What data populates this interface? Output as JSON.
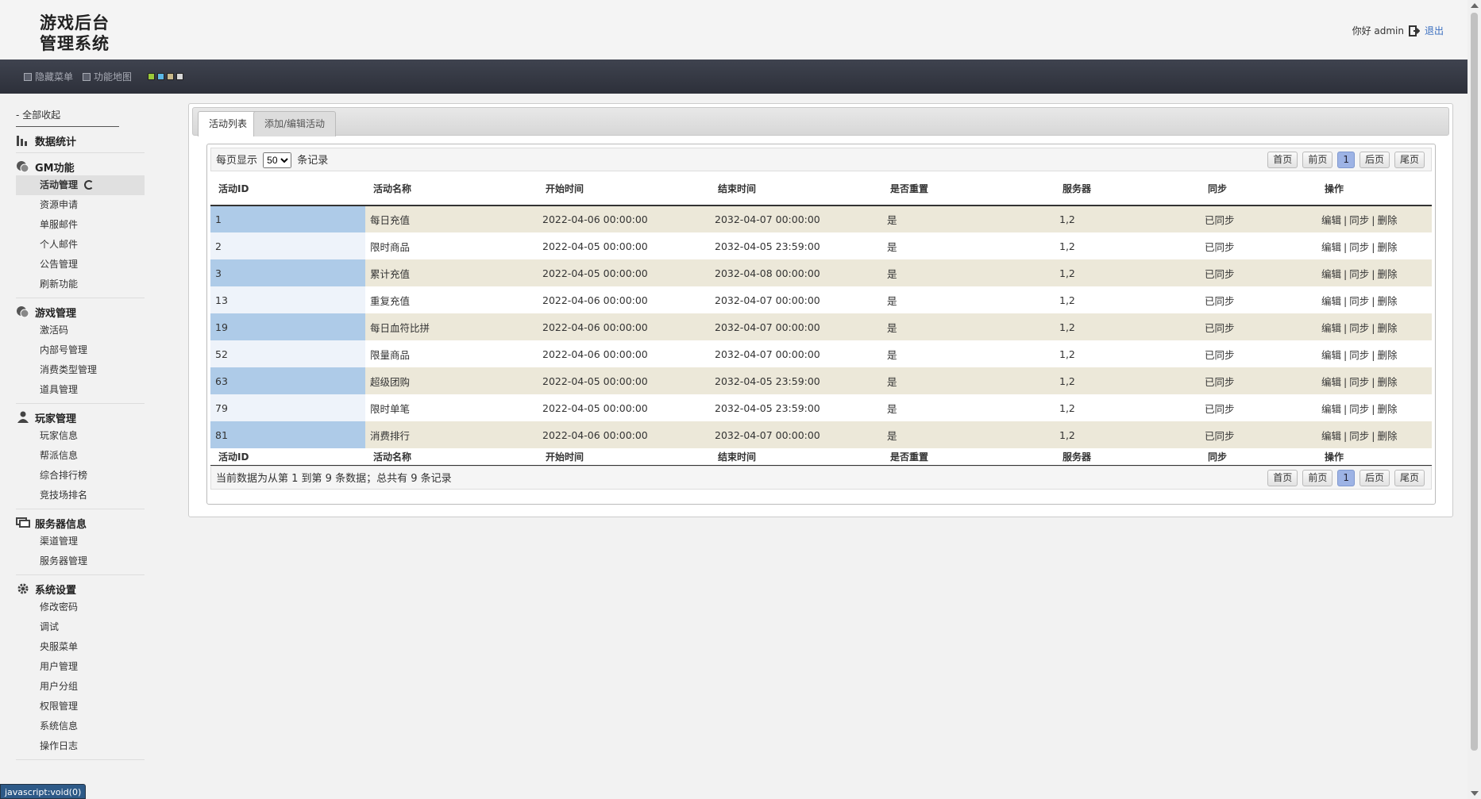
{
  "header": {
    "logo_line1": "游戏后台",
    "logo_line2": "管理系统",
    "greeting": "你好 admin",
    "logout": "退出"
  },
  "toolbar": {
    "hide_menu": "隐藏菜单",
    "feature_map": "功能地图",
    "swatch_colors": [
      "#9bc93a",
      "#5bb8e6",
      "#c9b98a",
      "#d8d8d8"
    ]
  },
  "sidebar": {
    "collapse_all": "- 全部收起",
    "groups": [
      {
        "title": "数据统计",
        "items": []
      },
      {
        "title": "GM功能",
        "items": [
          "活动管理",
          "资源申请",
          "单服邮件",
          "个人邮件",
          "公告管理",
          "刷新功能"
        ]
      },
      {
        "title": "游戏管理",
        "items": [
          "激活码",
          "内部号管理",
          "消费类型管理",
          "道具管理"
        ]
      },
      {
        "title": "玩家管理",
        "items": [
          "玩家信息",
          "帮派信息",
          "综合排行榜",
          "竞技场排名"
        ]
      },
      {
        "title": "服务器信息",
        "items": [
          "渠道管理",
          "服务器管理"
        ]
      },
      {
        "title": "系统设置",
        "items": [
          "修改密码",
          "调试",
          "央服菜单",
          "用户管理",
          "用户分组",
          "权限管理",
          "系统信息",
          "操作日志"
        ]
      }
    ]
  },
  "tabs": [
    "活动列表",
    "添加/编辑活动"
  ],
  "list": {
    "per_page_prefix": "每页显示",
    "per_page_value": "50",
    "per_page_suffix": "条记录",
    "pager": {
      "first": "首页",
      "prev": "前页",
      "current": "1",
      "next": "后页",
      "last": "尾页"
    },
    "columns": [
      "活动ID",
      "活动名称",
      "开始时间",
      "结束时间",
      "是否重置",
      "服务器",
      "同步",
      "操作"
    ],
    "rows": [
      {
        "id": "1",
        "name": "每日充值",
        "start": "2022-04-06 00:00:00",
        "end": "2032-04-07 00:00:00",
        "reset": "是",
        "server": "1,2",
        "sync": "已同步"
      },
      {
        "id": "2",
        "name": "限时商品",
        "start": "2022-04-05 00:00:00",
        "end": "2032-04-05 23:59:00",
        "reset": "是",
        "server": "1,2",
        "sync": "已同步"
      },
      {
        "id": "3",
        "name": "累计充值",
        "start": "2022-04-05 00:00:00",
        "end": "2032-04-08 00:00:00",
        "reset": "是",
        "server": "1,2",
        "sync": "已同步"
      },
      {
        "id": "13",
        "name": "重复充值",
        "start": "2022-04-06 00:00:00",
        "end": "2032-04-07 00:00:00",
        "reset": "是",
        "server": "1,2",
        "sync": "已同步"
      },
      {
        "id": "19",
        "name": "每日血符比拼",
        "start": "2022-04-06 00:00:00",
        "end": "2032-04-07 00:00:00",
        "reset": "是",
        "server": "1,2",
        "sync": "已同步"
      },
      {
        "id": "52",
        "name": "限量商品",
        "start": "2022-04-06 00:00:00",
        "end": "2032-04-07 00:00:00",
        "reset": "是",
        "server": "1,2",
        "sync": "已同步"
      },
      {
        "id": "63",
        "name": "超级团购",
        "start": "2022-04-05 00:00:00",
        "end": "2032-04-05 23:59:00",
        "reset": "是",
        "server": "1,2",
        "sync": "已同步"
      },
      {
        "id": "79",
        "name": "限时单笔",
        "start": "2022-04-05 00:00:00",
        "end": "2032-04-05 23:59:00",
        "reset": "是",
        "server": "1,2",
        "sync": "已同步"
      },
      {
        "id": "81",
        "name": "消费排行",
        "start": "2022-04-06 00:00:00",
        "end": "2032-04-07 00:00:00",
        "reset": "是",
        "server": "1,2",
        "sync": "已同步"
      }
    ],
    "ops": {
      "edit": "编辑",
      "sync": "同步",
      "delete": "删除"
    },
    "summary": "当前数据为从第 1 到第 9 条数据；总共有 9 条记录"
  },
  "status_bar": "javascript:void(0)"
}
